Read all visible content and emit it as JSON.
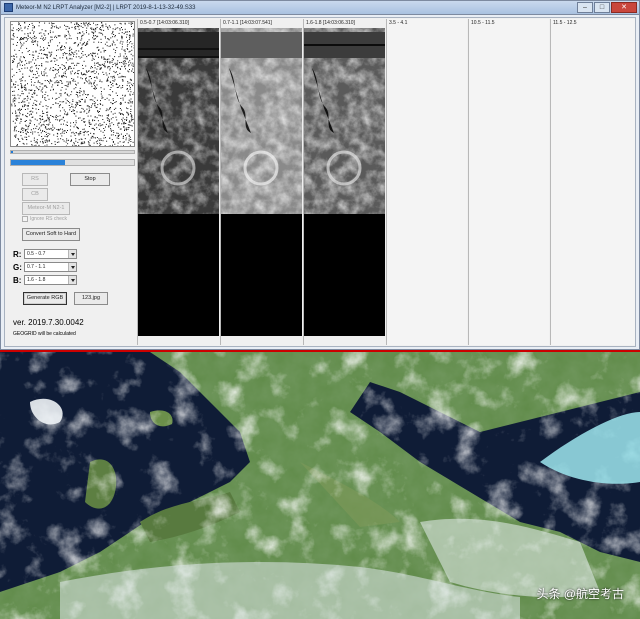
{
  "window": {
    "title": "Meteor-M N2 LRPT Analyzer [M2-2] | LRPT 2019-8-1-13-32-49.S33",
    "controls": {
      "minimize": "–",
      "maximize": "□",
      "close": "✕"
    }
  },
  "left_panel": {
    "progress": {
      "thin_fraction": 0.02,
      "main_fraction": 0.44
    },
    "buttons": {
      "rs": "RS",
      "stop": "Stop",
      "cb": "CB",
      "meteor": "Meteor-M N2-1",
      "convert": "Convert Soft to Hard",
      "generate": "Generate RGB",
      "jpg": "123.jpg"
    },
    "checkbox": {
      "label": "Ignore RS check",
      "checked": false
    },
    "rgb": {
      "r": {
        "letter": "R:",
        "value": "0.5 - 0.7"
      },
      "g": {
        "letter": "G:",
        "value": "0.7 - 1.1"
      },
      "b": {
        "letter": "B:",
        "value": "1.6 - 1.8"
      }
    },
    "version": "ver. 2019.7.30.0042",
    "geogrid_note": "GEOGRID will be calculated"
  },
  "channels": [
    {
      "label": "0.5-0.7 [14:03:06.310]",
      "has_image": true,
      "tone": "dark"
    },
    {
      "label": "0.7-1.1 [14:03:07.541]",
      "has_image": true,
      "tone": "light"
    },
    {
      "label": "1.6-1.8 [14:03:06.310]",
      "has_image": true,
      "tone": "mid"
    },
    {
      "label": "3.5 - 4.1",
      "has_image": false
    },
    {
      "label": "10.5 - 11.5",
      "has_image": false
    },
    {
      "label": "11.5 - 12.5",
      "has_image": false
    }
  ],
  "watermark": "头条 @航空考古",
  "colors": {
    "progress_fill": "#2a82d9",
    "land": "#5f8a48",
    "sea": "#12223d",
    "cloud": "#e8eef2",
    "ice_cyan": "#9ee6ef"
  }
}
